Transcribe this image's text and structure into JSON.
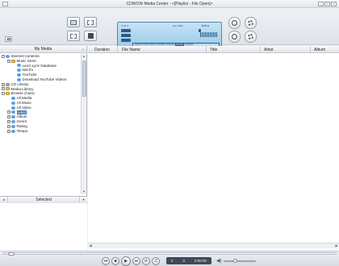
{
  "window": {
    "title": "CDWOW Media Center - <[Playlist - File Open]>",
    "controls": [
      "_",
      "□",
      "×"
    ]
  },
  "lcd": {
    "top_left": "⟲ ⚙ ↺",
    "top_mid": "⊕ ▸ ♦ Bal",
    "top_right": "⇆ ⇆ ⊞",
    "strip_text": "MUSIC  POP  JAZZ  CLASSIC  VOCAL",
    "strip_selected": "ROCK",
    "strip_after": "DANCE"
  },
  "sidebar": {
    "header": "My Media",
    "tree": [
      {
        "label": "Internet Contents",
        "level": 0,
        "expander": "−",
        "icon": "globe"
      },
      {
        "label": "Music Store",
        "level": 1,
        "expander": "+",
        "icon": "folder"
      },
      {
        "label": "Leo's Lyric Database",
        "level": 2,
        "expander": "",
        "icon": "globe"
      },
      {
        "label": "last.fm",
        "level": 2,
        "expander": "",
        "icon": "globe"
      },
      {
        "label": "YouTube",
        "level": 2,
        "expander": "",
        "icon": "globe"
      },
      {
        "label": "Download YouTube Videos",
        "level": 2,
        "expander": "",
        "icon": "globe"
      },
      {
        "label": "CD Library",
        "level": 0,
        "expander": "+",
        "icon": "drive"
      },
      {
        "label": "Media Library",
        "level": 0,
        "expander": "+",
        "icon": "folder"
      },
      {
        "label": "Browse (Auto)",
        "level": 0,
        "expander": "−",
        "icon": "folder"
      },
      {
        "label": "All Media",
        "level": 1,
        "expander": "",
        "icon": "globe"
      },
      {
        "label": "All Music",
        "level": 1,
        "expander": "",
        "icon": "globe"
      },
      {
        "label": "All Video",
        "level": 1,
        "expander": "",
        "icon": "globe"
      },
      {
        "label": "Artist",
        "level": 1,
        "expander": "+",
        "icon": "globe",
        "selected": true
      },
      {
        "label": "Album",
        "level": 1,
        "expander": "+",
        "icon": "globe"
      },
      {
        "label": "Genre",
        "level": 1,
        "expander": "+",
        "icon": "globe"
      },
      {
        "label": "Rating",
        "level": 1,
        "expander": "+",
        "icon": "globe"
      },
      {
        "label": "Tempo",
        "level": 1,
        "expander": "+",
        "icon": "globe"
      }
    ],
    "selected_tab": "Selected"
  },
  "list": {
    "columns": [
      "Duration",
      "File Name",
      "Title",
      "Artist",
      "Album"
    ]
  },
  "player": {
    "time_left": "0",
    "time_mid": "0",
    "time_right": "0:00:00"
  }
}
